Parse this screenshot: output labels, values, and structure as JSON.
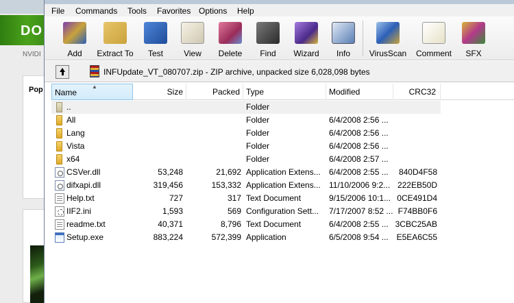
{
  "background": {
    "banner_text": "DO",
    "brand_text": "NVIDI",
    "panel_heading": "Pop"
  },
  "menu": [
    "File",
    "Commands",
    "Tools",
    "Favorites",
    "Options",
    "Help"
  ],
  "toolbar": [
    {
      "label": "Add",
      "icon": "add-archive-icon",
      "color": "#7b3fb0"
    },
    {
      "label": "Extract To",
      "icon": "extract-folder-icon",
      "color": "#c9a23a"
    },
    {
      "label": "Test",
      "icon": "test-checkmark-icon",
      "color": "#2c5fb8"
    },
    {
      "label": "View",
      "icon": "view-glasses-icon",
      "color": "#d9d4c4"
    },
    {
      "label": "Delete",
      "icon": "delete-icon",
      "color": "#c44a6a"
    },
    {
      "label": "Find",
      "icon": "find-binoculars-icon",
      "color": "#4a4a4a"
    },
    {
      "label": "Wizard",
      "icon": "wizard-hat-icon",
      "color": "#7a4cc0"
    },
    {
      "label": "Info",
      "icon": "info-icon",
      "color": "#5a7fb5"
    },
    {
      "label": "VirusScan",
      "icon": "virusscan-icon",
      "color": "#3c6fb0"
    },
    {
      "label": "Comment",
      "icon": "comment-icon",
      "color": "#e8e2c8"
    },
    {
      "label": "SFX",
      "icon": "sfx-archive-icon",
      "color": "#b23a8a"
    }
  ],
  "address": {
    "text": "INFUpdate_VT_080707.zip - ZIP archive, unpacked size 6,028,098 bytes"
  },
  "columns": {
    "name": "Name",
    "size": "Size",
    "packed": "Packed",
    "type": "Type",
    "modified": "Modified",
    "crc": "CRC32"
  },
  "files": [
    {
      "name": "..",
      "size": "",
      "packed": "",
      "type": "Folder",
      "modified": "",
      "crc": "",
      "icon": "parent-folder-icon"
    },
    {
      "name": "All",
      "size": "",
      "packed": "",
      "type": "Folder",
      "modified": "6/4/2008 2:56 ...",
      "crc": "",
      "icon": "folder-icon"
    },
    {
      "name": "Lang",
      "size": "",
      "packed": "",
      "type": "Folder",
      "modified": "6/4/2008 2:56 ...",
      "crc": "",
      "icon": "folder-icon"
    },
    {
      "name": "Vista",
      "size": "",
      "packed": "",
      "type": "Folder",
      "modified": "6/4/2008 2:56 ...",
      "crc": "",
      "icon": "folder-icon"
    },
    {
      "name": "x64",
      "size": "",
      "packed": "",
      "type": "Folder",
      "modified": "6/4/2008 2:57 ...",
      "crc": "",
      "icon": "folder-icon"
    },
    {
      "name": "CSVer.dll",
      "size": "53,248",
      "packed": "21,692",
      "type": "Application Extens...",
      "modified": "6/4/2008 2:55 ...",
      "crc": "840D4F58",
      "icon": "dll-icon"
    },
    {
      "name": "difxapi.dll",
      "size": "319,456",
      "packed": "153,332",
      "type": "Application Extens...",
      "modified": "11/10/2006 9:2...",
      "crc": "222EB50D",
      "icon": "dll-icon"
    },
    {
      "name": "Help.txt",
      "size": "727",
      "packed": "317",
      "type": "Text Document",
      "modified": "9/15/2006 10:1...",
      "crc": "0CE491D4",
      "icon": "text-file-icon"
    },
    {
      "name": "IIF2.ini",
      "size": "1,593",
      "packed": "569",
      "type": "Configuration Sett...",
      "modified": "7/17/2007 8:52 ...",
      "crc": "F74BB0F6",
      "icon": "ini-file-icon"
    },
    {
      "name": "readme.txt",
      "size": "40,371",
      "packed": "8,796",
      "type": "Text Document",
      "modified": "6/4/2008 2:55 ...",
      "crc": "3CBC25AB",
      "icon": "text-file-icon"
    },
    {
      "name": "Setup.exe",
      "size": "883,224",
      "packed": "572,399",
      "type": "Application",
      "modified": "6/5/2008 9:54 ...",
      "crc": "E5EA6C55",
      "icon": "exe-icon"
    }
  ]
}
